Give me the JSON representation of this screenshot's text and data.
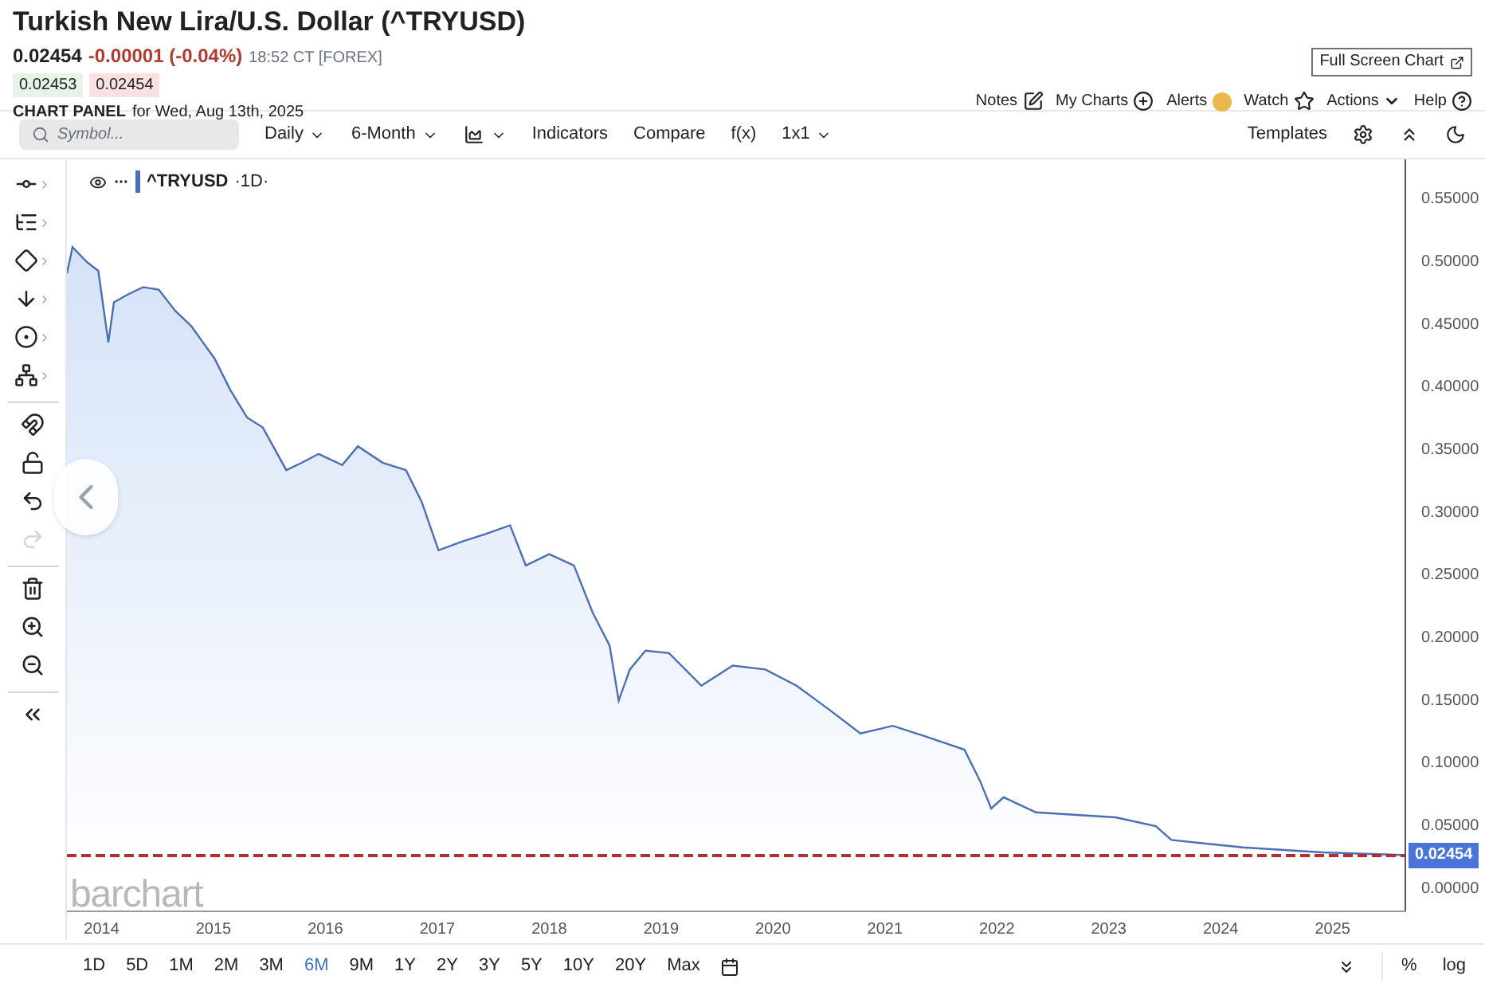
{
  "header": {
    "title": "Turkish New Lira/U.S. Dollar (^TRYUSD)",
    "last": "0.02454",
    "change": "-0.00001 (-0.04%)",
    "time": "18:52 CT [FOREX]",
    "bid": "0.02453",
    "ask": "0.02454",
    "panel_label": "CHART PANEL",
    "panel_date": "for Wed, Aug 13th, 2025",
    "full_screen_button": "Full Screen Chart"
  },
  "links": [
    {
      "label": "Notes",
      "kind": "notes"
    },
    {
      "label": "My Charts",
      "kind": "charts"
    },
    {
      "label": "Alerts",
      "kind": "alerts"
    },
    {
      "label": "Watch",
      "kind": "watch"
    },
    {
      "label": "Actions",
      "kind": "actions"
    },
    {
      "label": "Help",
      "kind": "help"
    }
  ],
  "toolbar": {
    "search_placeholder": "Symbol...",
    "items": [
      {
        "label": "Daily",
        "kind": "dropdown"
      },
      {
        "label": "6-Month",
        "kind": "dropdown"
      },
      {
        "kind": "charttype"
      },
      {
        "label": "Indicators",
        "kind": "button"
      },
      {
        "label": "Compare",
        "kind": "button"
      },
      {
        "label": "f(x)",
        "kind": "button"
      },
      {
        "label": "1x1",
        "kind": "dropdown"
      }
    ],
    "templates": "Templates"
  },
  "tools": [
    {
      "kind": "line",
      "disabled": false
    },
    {
      "kind": "fib",
      "disabled": false
    },
    {
      "kind": "shape",
      "disabled": false
    },
    {
      "kind": "arrow",
      "disabled": false
    },
    {
      "kind": "number",
      "disabled": false
    },
    {
      "kind": "pattern",
      "disabled": false
    },
    {
      "kind": "magnet",
      "disabled": false
    },
    {
      "kind": "lock",
      "disabled": false
    },
    {
      "kind": "undo",
      "disabled": false
    },
    {
      "kind": "redo",
      "disabled": true
    },
    {
      "kind": "trash",
      "disabled": false
    },
    {
      "kind": "zoomin",
      "disabled": false
    },
    {
      "kind": "zoomout",
      "disabled": false
    },
    {
      "kind": "collapse",
      "disabled": false
    }
  ],
  "chart": {
    "legend_interval": "·1D·",
    "logo": "barchart",
    "chart_data": {
      "type": "area",
      "xlim": [
        2013.69,
        2025.65
      ],
      "ylim": [
        -0.02,
        0.58
      ],
      "ref_lines": [
        {
          "axis": "y",
          "value": 0.02454,
          "label": "0.02454",
          "color": "#b22f2f"
        }
      ],
      "xticks": [
        2014,
        2015,
        2016,
        2017,
        2018,
        2019,
        2020,
        2021,
        2022,
        2023,
        2024,
        2025
      ],
      "yticks": [
        {
          "value": 0.55,
          "label": "0.55000"
        },
        {
          "value": 0.5,
          "label": "0.50000"
        },
        {
          "value": 0.45,
          "label": "0.45000"
        },
        {
          "value": 0.4,
          "label": "0.40000"
        },
        {
          "value": 0.35,
          "label": "0.35000"
        },
        {
          "value": 0.3,
          "label": "0.30000"
        },
        {
          "value": 0.25,
          "label": "0.25000"
        },
        {
          "value": 0.2,
          "label": "0.20000"
        },
        {
          "value": 0.15,
          "label": "0.15000"
        },
        {
          "value": 0.1,
          "label": "0.10000"
        },
        {
          "value": 0.05,
          "label": "0.05000"
        },
        {
          "value": 0,
          "label": "0.00000"
        }
      ],
      "x": [
        2013.69,
        2013.74,
        2013.87,
        2013.97,
        2014.06,
        2014.11,
        2014.23,
        2014.37,
        2014.51,
        2014.66,
        2014.8,
        2015.01,
        2015.15,
        2015.3,
        2015.44,
        2015.65,
        2015.79,
        2015.94,
        2016.15,
        2016.29,
        2016.51,
        2016.72,
        2016.86,
        2017.01,
        2017.22,
        2017.43,
        2017.65,
        2017.79,
        2018.0,
        2018.22,
        2018.39,
        2018.54,
        2018.62,
        2018.72,
        2018.86,
        2019.07,
        2019.36,
        2019.64,
        2019.93,
        2020.21,
        2020.5,
        2020.78,
        2021.07,
        2021.35,
        2021.71,
        2021.85,
        2021.95,
        2022.06,
        2022.35,
        2023.06,
        2023.42,
        2023.56,
        2024.2,
        2024.91,
        2025.62
      ],
      "series": [
        {
          "name": "^TRYUSD",
          "color": "#4a6fb5",
          "values": [
            0.489,
            0.51,
            0.498,
            0.491,
            0.434,
            0.466,
            0.472,
            0.478,
            0.476,
            0.459,
            0.447,
            0.421,
            0.396,
            0.374,
            0.366,
            0.332,
            0.338,
            0.345,
            0.336,
            0.351,
            0.338,
            0.332,
            0.307,
            0.268,
            0.275,
            0.281,
            0.288,
            0.256,
            0.265,
            0.256,
            0.218,
            0.192,
            0.148,
            0.173,
            0.188,
            0.186,
            0.16,
            0.176,
            0.173,
            0.16,
            0.141,
            0.122,
            0.128,
            0.12,
            0.109,
            0.084,
            0.062,
            0.071,
            0.059,
            0.055,
            0.048,
            0.037,
            0.031,
            0.027,
            0.025
          ]
        }
      ]
    }
  },
  "ranges": [
    {
      "label": "1D",
      "selected": false
    },
    {
      "label": "5D",
      "selected": false
    },
    {
      "label": "1M",
      "selected": false
    },
    {
      "label": "2M",
      "selected": false
    },
    {
      "label": "3M",
      "selected": false
    },
    {
      "label": "6M",
      "selected": true
    },
    {
      "label": "9M",
      "selected": false
    },
    {
      "label": "1Y",
      "selected": false
    },
    {
      "label": "2Y",
      "selected": false
    },
    {
      "label": "3Y",
      "selected": false
    },
    {
      "label": "5Y",
      "selected": false
    },
    {
      "label": "10Y",
      "selected": false
    },
    {
      "label": "20Y",
      "selected": false
    },
    {
      "label": "Max",
      "selected": false
    }
  ],
  "scale_buttons": [
    "%",
    "log"
  ]
}
